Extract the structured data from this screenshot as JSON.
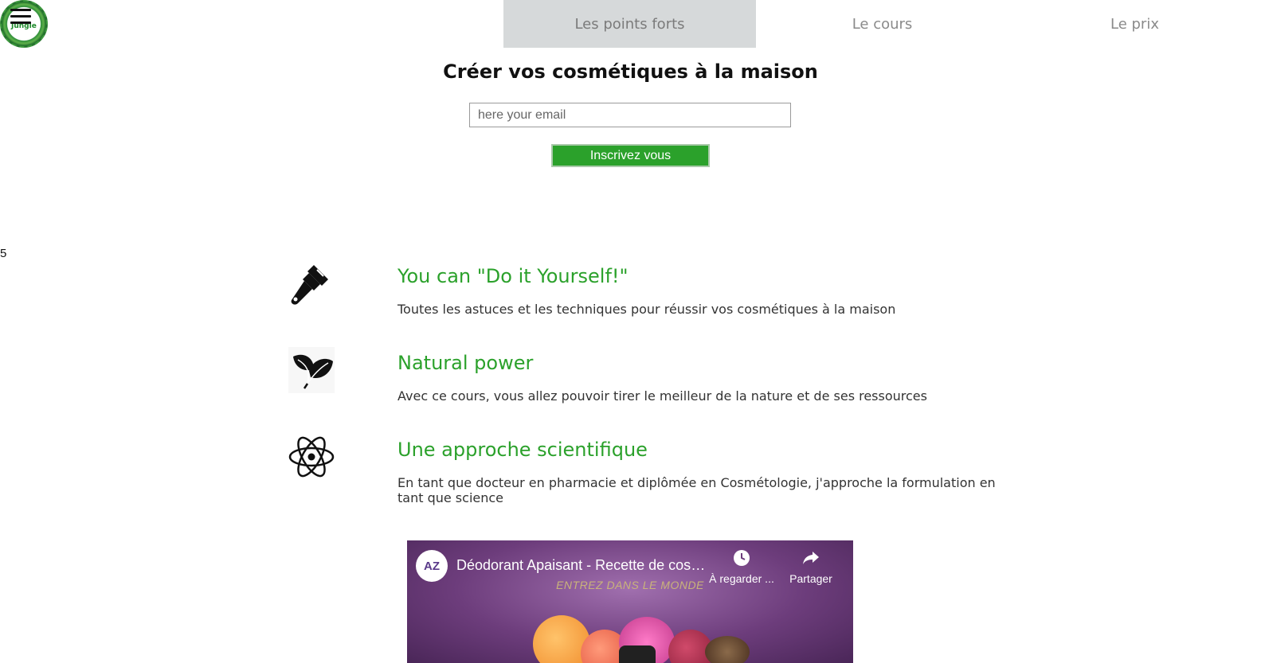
{
  "brand": {
    "logo_text": "Jungle"
  },
  "nav": {
    "tabs": [
      {
        "label": "Les points forts",
        "active": true
      },
      {
        "label": "Le cours",
        "active": false
      },
      {
        "label": "Le prix",
        "active": false
      }
    ]
  },
  "hero": {
    "title": "Créer vos cosmétiques à la maison",
    "email_placeholder": "here your email",
    "submit_label": "Inscrivez vous"
  },
  "side_marker": "5",
  "features": [
    {
      "icon": "paintbrush-icon",
      "title": "You can \"Do it Yourself!\"",
      "description": "Toutes les astuces et les techniques pour réussir vos cosmétiques à la maison"
    },
    {
      "icon": "leaf-icon",
      "title": "Natural power",
      "description": "Avec ce cours, vous allez pouvoir tirer le meilleur de la nature et de ses ressources"
    },
    {
      "icon": "atom-icon",
      "title": "Une approche scientifique",
      "description": "En tant que docteur en pharmacie et diplômée en Cosmétologie, j'approche la formulation en tant que science"
    }
  ],
  "video": {
    "channel_initials": "AZ",
    "title": "Déodorant Apaisant - Recette de cosmétique",
    "watch_later_label": "À regarder ...",
    "share_label": "Partager",
    "banner_text": "ENTREZ DANS LE MONDE"
  },
  "colors": {
    "accent_green": "#2ba12b",
    "nav_active_bg": "#d6d9da",
    "video_bg": "#6d3d7c"
  }
}
